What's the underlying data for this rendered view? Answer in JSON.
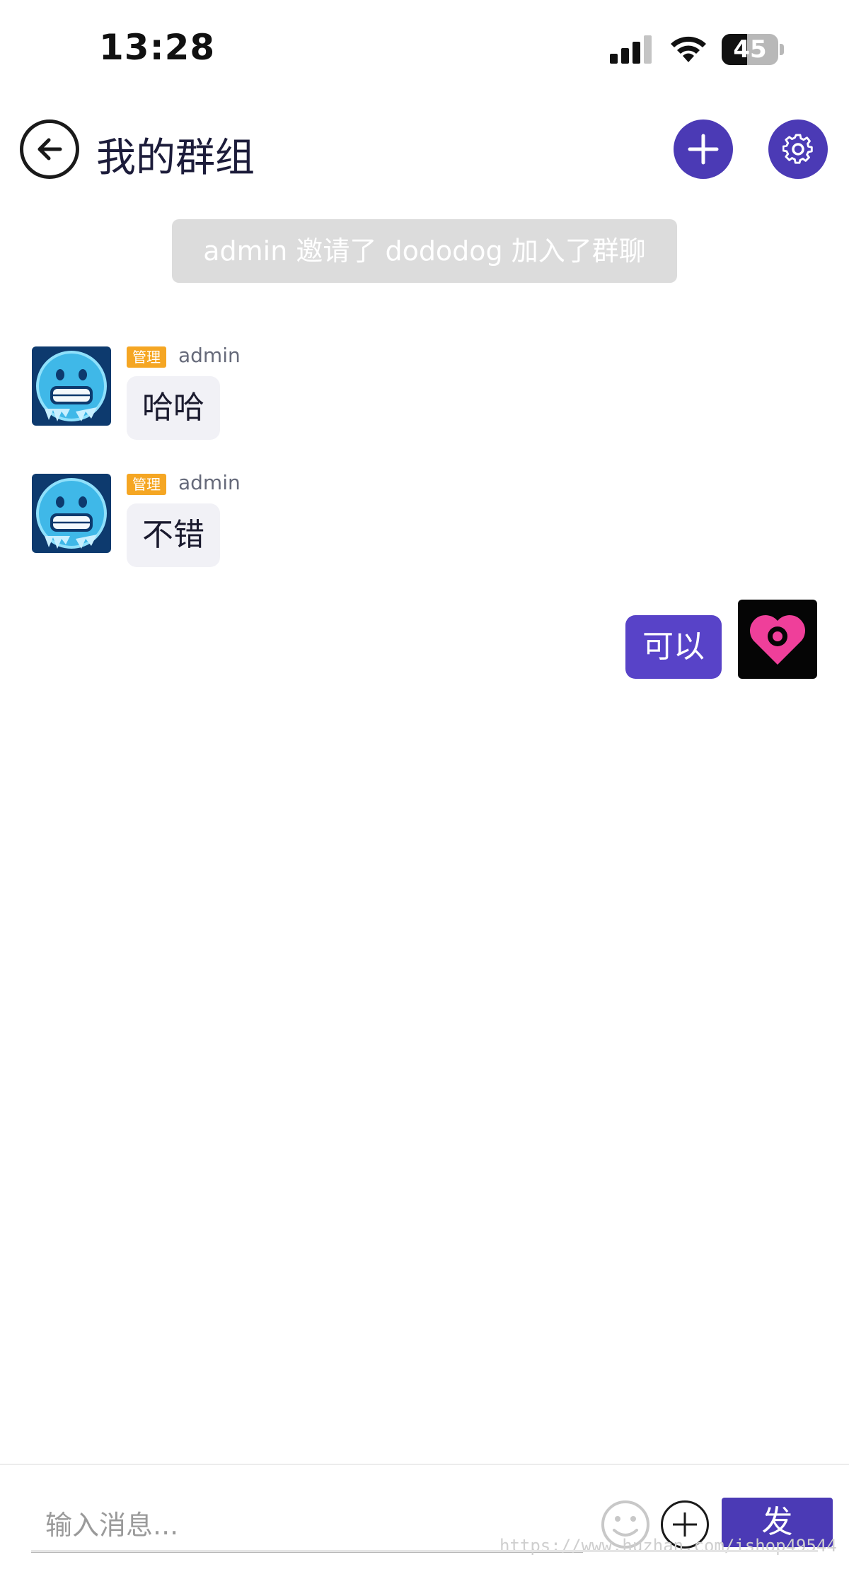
{
  "status_bar": {
    "time": "13:28",
    "battery": "45",
    "battery_level": 0.45,
    "icons": [
      "signal-icon",
      "wifi-icon",
      "battery-icon"
    ]
  },
  "header": {
    "title": "我的群组",
    "back_icon": "arrow-left-icon",
    "add_icon": "plus-icon",
    "settings_icon": "gear-icon"
  },
  "system_message": "admin 邀请了 dododog 加入了群聊",
  "messages": [
    {
      "sender": "admin",
      "badge": "管理",
      "text": "哈哈",
      "direction": "incoming",
      "avatar": "freezing-face-avatar"
    },
    {
      "sender": "admin",
      "badge": "管理",
      "text": "不错",
      "direction": "incoming",
      "avatar": "freezing-face-avatar"
    },
    {
      "text": "可以",
      "direction": "outgoing",
      "avatar": "pink-heart-pin-avatar"
    }
  ],
  "input_bar": {
    "placeholder": "输入消息...",
    "send_label": "发",
    "emoji_icon": "smiley-icon",
    "plus_icon": "plus-circle-icon",
    "watermark": "https://www.huzhan.com/ishop49544"
  },
  "colors": {
    "accent": "#4b3ab5",
    "outgoing_bubble": "#5843c8",
    "incoming_bubble": "#f1f1f6",
    "badge": "#f5a623",
    "system_bg": "#dcdcdc"
  }
}
